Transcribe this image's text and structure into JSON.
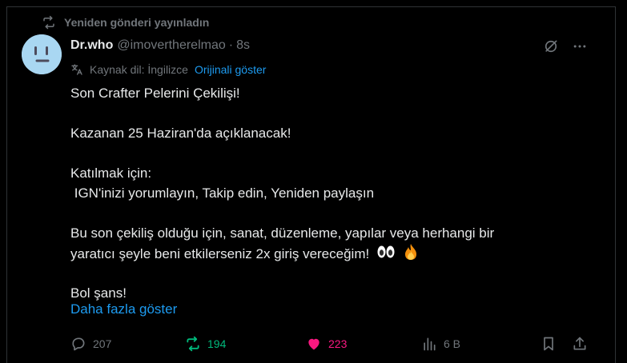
{
  "repost_notice": "Yeniden gönderi yayınladın",
  "post": {
    "author_name": "Dr.who",
    "author_handle": "@imovertherelmao",
    "separator": "·",
    "time": "8s",
    "translation": {
      "label": "Kaynak dil: İngilizce",
      "link": "Orijinali göster"
    },
    "lines": [
      "Son Crafter Pelerini Çekilişi!",
      "",
      "Kazanan 25 Haziran'da açıklanacak!",
      "",
      "Katılmak için:",
      " IGN'inizi yorumlayın, Takip edin, Yeniden paylaşın",
      "",
      "Bu son çekiliş olduğu için, sanat, düzenleme, yapılar veya herhangi bir",
      "yaratıcı şeyle beni etkilerseniz 2x giriş vereceğim!",
      "",
      "Bol şans!"
    ],
    "emojis": [
      "eyes-emoji",
      "fire-emoji"
    ],
    "show_more": "Daha fazla göster"
  },
  "actions": {
    "replies": "207",
    "reposts": "194",
    "likes": "223",
    "views": "6 B"
  },
  "colors": {
    "background": "#000000",
    "text": "#e7e9ea",
    "muted": "#71767b",
    "link": "#1d9bf0",
    "repost_active": "#00ba7c",
    "like_active": "#f91880",
    "avatar_bg": "#a9d7f2"
  }
}
